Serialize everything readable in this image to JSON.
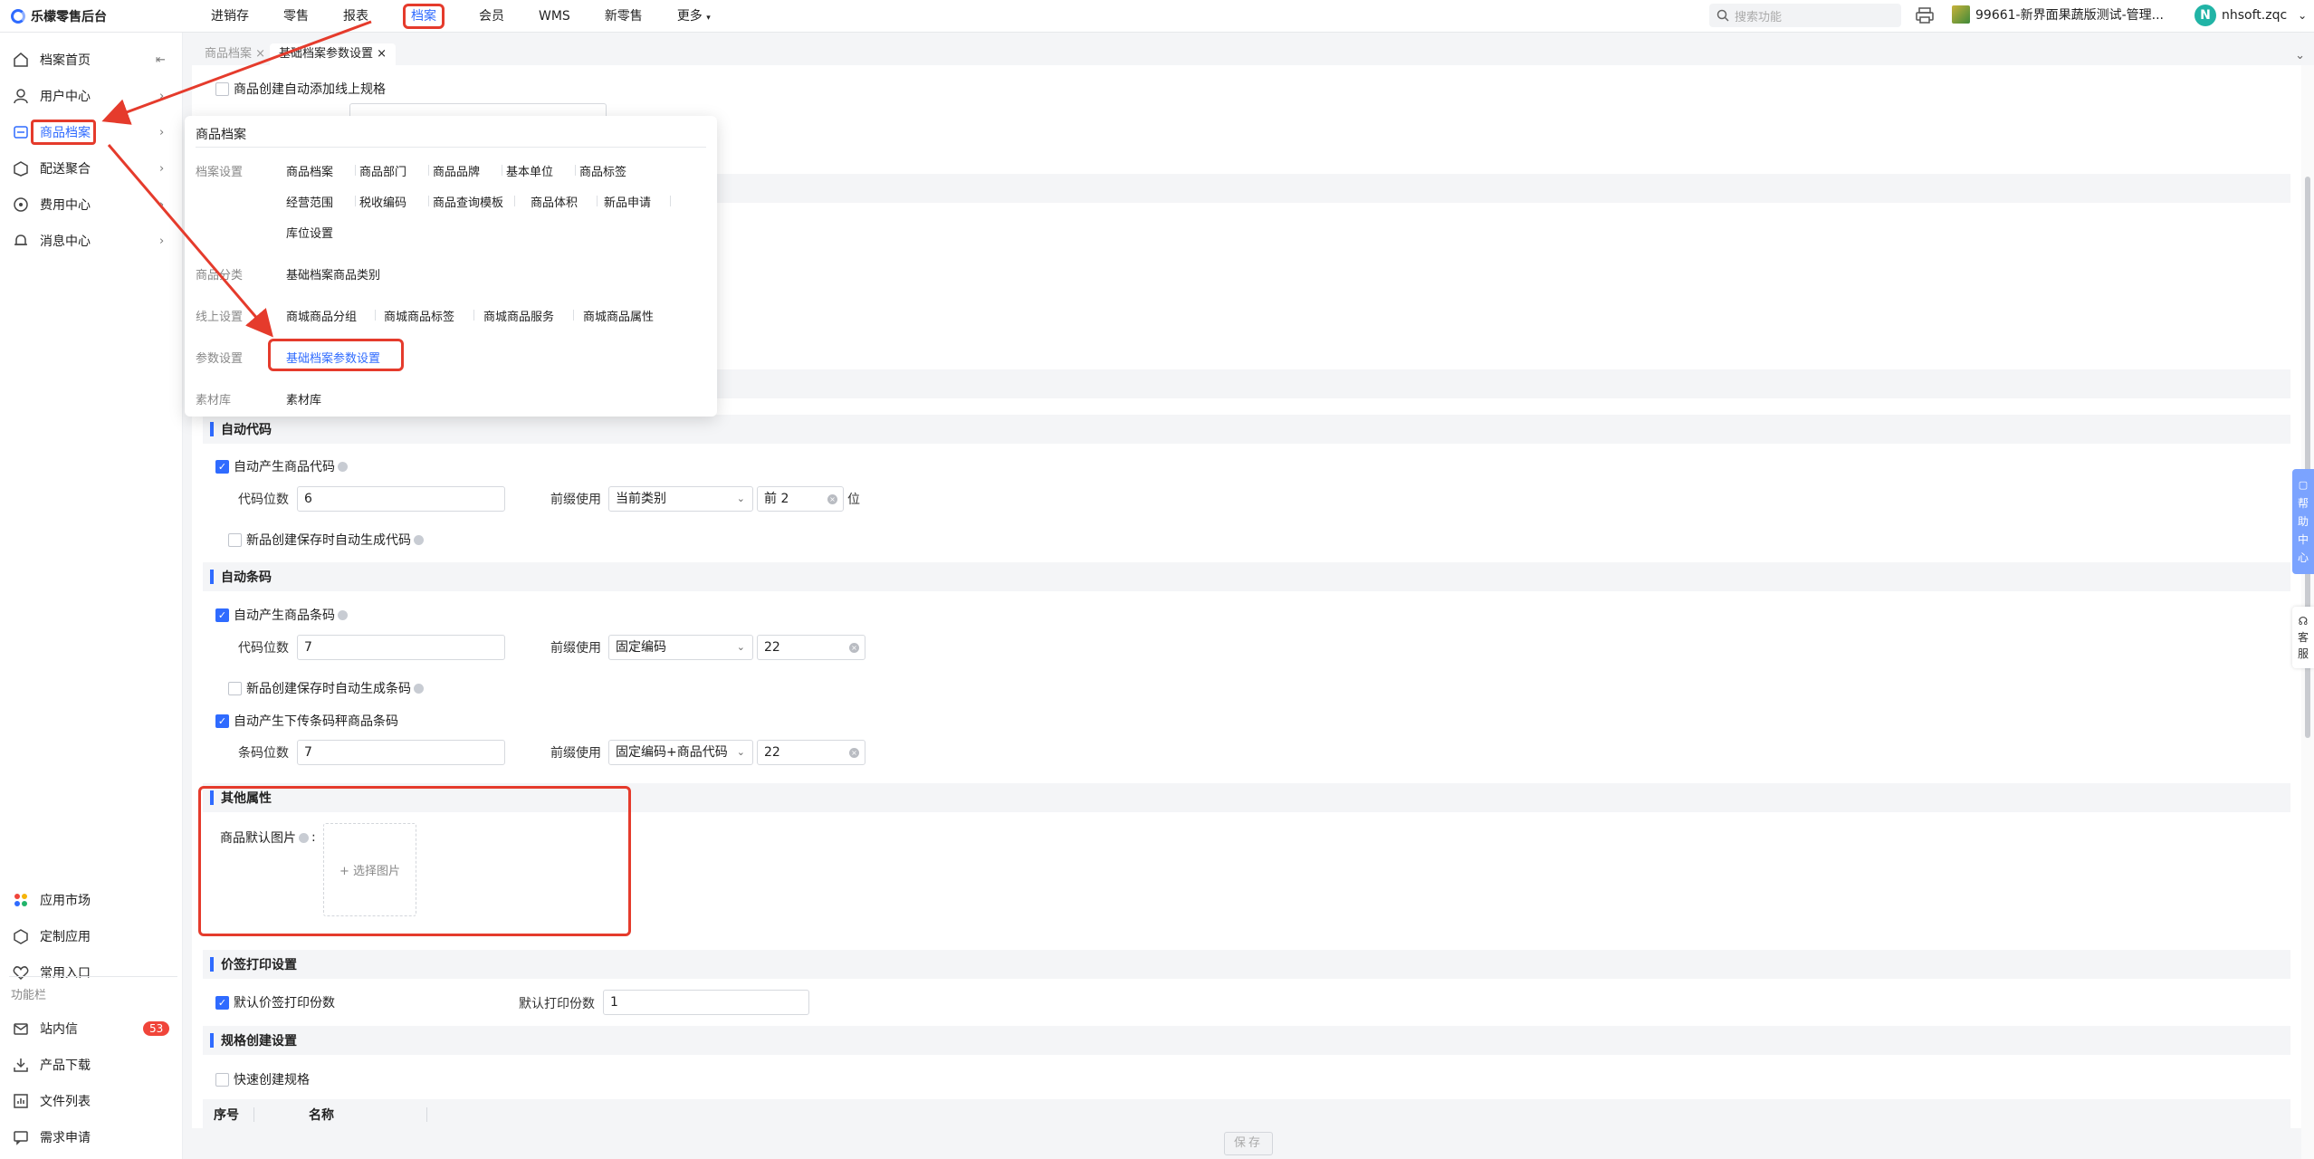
{
  "app": {
    "title": "乐檬零售后台"
  },
  "topnav": [
    "进销存",
    "零售",
    "报表",
    "档案",
    "会员",
    "WMS",
    "新零售",
    "更多"
  ],
  "topnav_active": "档案",
  "search": {
    "placeholder": "搜索功能"
  },
  "store": {
    "name": "99661-新界面果蔬版测试-管理..."
  },
  "user": {
    "initial": "N",
    "name": "nhsoft.zqc"
  },
  "sidebar": {
    "items": [
      {
        "label": "档案首页"
      },
      {
        "label": "用户中心"
      },
      {
        "label": "商品档案"
      },
      {
        "label": "配送聚合"
      },
      {
        "label": "费用中心"
      },
      {
        "label": "消息中心"
      }
    ],
    "bottom": [
      {
        "label": "应用市场"
      },
      {
        "label": "定制应用"
      },
      {
        "label": "常用入口"
      }
    ],
    "section_label": "功能栏",
    "tools": [
      {
        "label": "站内信",
        "badge": "53"
      },
      {
        "label": "产品下载"
      },
      {
        "label": "文件列表"
      },
      {
        "label": "需求申请"
      }
    ]
  },
  "tabs": [
    {
      "label": "商品档案"
    },
    {
      "label": "基础档案参数设置"
    }
  ],
  "top_partial": {
    "label": "商品创建自动添加线上规格"
  },
  "popover": {
    "title": "商品档案",
    "groups": [
      {
        "category": "档案设置",
        "links": [
          "商品档案",
          "商品部门",
          "商品品牌",
          "基本单位",
          "商品标签",
          "经营范围",
          "税收编码",
          "商品查询模板",
          "商品体积",
          "新品申请",
          "库位设置"
        ]
      },
      {
        "category": "商品分类",
        "links": [
          "基础档案商品类别"
        ]
      },
      {
        "category": "线上设置",
        "links": [
          "商城商品分组",
          "商城商品标签",
          "商城商品服务",
          "商城商品属性"
        ]
      },
      {
        "category": "参数设置",
        "links": [
          "基础档案参数设置"
        ]
      },
      {
        "category": "素材库",
        "links": [
          "素材库"
        ]
      }
    ]
  },
  "auto_code": {
    "section": "自动代码",
    "enable_label": "自动产生商品代码",
    "digits_label": "代码位数",
    "digits_value": "6",
    "prefix_label": "前缀使用",
    "prefix_value": "当前类别",
    "prefix_input": "前 2",
    "unit": "位",
    "new_label": "新品创建保存时自动生成代码"
  },
  "auto_barcode": {
    "section": "自动条码",
    "enable_label": "自动产生商品条码",
    "digits_label": "代码位数",
    "digits_value": "7",
    "prefix_label": "前缀使用",
    "prefix_value": "固定编码",
    "prefix_input": "22",
    "new_label": "新品创建保存时自动生成条码",
    "scale_label": "自动产生下传条码秤商品条码",
    "scale_digits_label": "条码位数",
    "scale_digits_value": "7",
    "scale_prefix_label": "前缀使用",
    "scale_prefix_value": "固定编码+商品代码",
    "scale_prefix_input": "22"
  },
  "other": {
    "section": "其他属性",
    "default_image_label": "商品默认图片",
    "colon": ":",
    "upload_label": "+ 选择图片"
  },
  "price_label": {
    "section": "价签打印设置",
    "default_copies_label": "默认价签打印份数",
    "copies_label": "默认打印份数",
    "copies_value": "1"
  },
  "spec": {
    "section": "规格创建设置",
    "quick_label": "快速创建规格",
    "col_index": "序号",
    "col_name": "名称"
  },
  "footer": {
    "save_label": "保存"
  },
  "help": {
    "chars": [
      "帮",
      "助",
      "中",
      "心"
    ]
  },
  "service": {
    "chars": [
      "客",
      "服"
    ]
  },
  "colors": {
    "accent": "#2f6bff",
    "annotation": "#e53b2c"
  }
}
